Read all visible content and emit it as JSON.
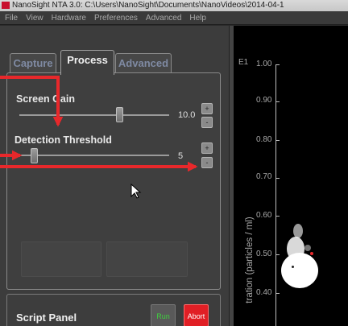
{
  "window": {
    "title": "NanoSight NTA 3.0: C:\\Users\\NanoSight\\Documents\\NanoVideos\\2014-04-1"
  },
  "menu": [
    "File",
    "View",
    "Hardware",
    "Preferences",
    "Advanced",
    "Help"
  ],
  "tabs": {
    "capture": "Capture",
    "process": "Process",
    "advanced": "Advanced"
  },
  "process": {
    "screen_gain": {
      "label": "Screen Gain",
      "value": "10.0",
      "level": 0.67
    },
    "detection_threshold": {
      "label": "Detection Threshold",
      "value": "5",
      "level": 0.1
    },
    "stepper_up": "+",
    "stepper_down": "-"
  },
  "script_panel": {
    "label": "Script Panel",
    "run": "Run",
    "abort": "Abort"
  },
  "plot": {
    "corner_label": "E1",
    "y_ticks": [
      "1.00",
      "0.90",
      "0.80",
      "0.70",
      "0.60",
      "0.50",
      "0.40"
    ],
    "ylabel": "tration (particles / ml)"
  },
  "colors": {
    "annotation_red": "#e8282b",
    "abort_red": "#e11f25",
    "run_green": "#3ed13e"
  }
}
